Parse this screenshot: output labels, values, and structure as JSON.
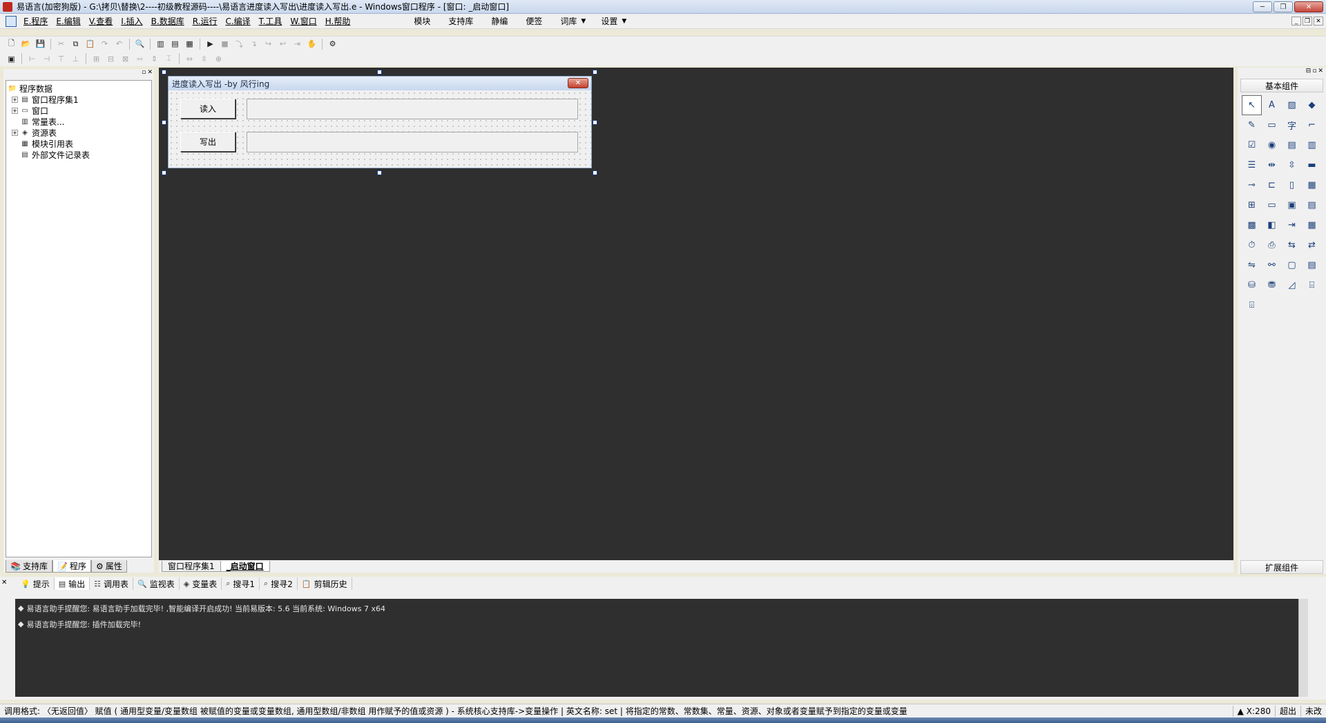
{
  "window": {
    "title": "易语言(加密狗版) - G:\\拷贝\\替换\\2----初级教程源码----\\易语言进度读入写出\\进度读入写出.e - Windows窗口程序 - [窗口: _启动窗口]",
    "min": "─",
    "max": "❐",
    "close": "✕"
  },
  "menu": {
    "items": [
      "E.程序",
      "E.编辑",
      "V.查看",
      "I.插入",
      "B.数据库",
      "R.运行",
      "C.编译",
      "T.工具",
      "W.窗口",
      "H.帮助"
    ],
    "extra": [
      "模块",
      "支持库",
      "静编",
      "便签",
      "词库",
      "设置"
    ],
    "mdi": [
      "_",
      "❐",
      "✕"
    ]
  },
  "left_panel": {
    "tree": [
      {
        "label": "程序数据",
        "expand": "",
        "icon": "📁"
      },
      {
        "label": "窗口程序集1",
        "expand": "+",
        "icon": "▤"
      },
      {
        "label": "窗口",
        "expand": "+",
        "icon": "▭"
      },
      {
        "label": "常量表...",
        "expand": "",
        "icon": "▥"
      },
      {
        "label": "资源表",
        "expand": "+",
        "icon": "◈"
      },
      {
        "label": "模块引用表",
        "expand": "",
        "icon": "▦"
      },
      {
        "label": "外部文件记录表",
        "expand": "",
        "icon": "▤"
      }
    ],
    "tabs": [
      "支持库",
      "程序",
      "属性"
    ]
  },
  "designer": {
    "title": "进度读入写出 -by 风行ing",
    "close": "✕",
    "read_button": "读入",
    "write_button": "写出"
  },
  "center_tabs": [
    "窗口程序集1",
    "_启动窗口"
  ],
  "right_panel": {
    "header": "基本组件",
    "footer": "扩展组件"
  },
  "output": {
    "tabs": [
      "提示",
      "输出",
      "调用表",
      "监视表",
      "变量表",
      "搜寻1",
      "搜寻2",
      "剪辑历史"
    ],
    "lines": [
      "易语言助手提醒您: 易语言助手加载完毕! ,智能编译开启成功! 当前易版本: 5.6  当前系统: Windows 7 x64",
      "易语言助手提醒您: 插件加载完毕!"
    ]
  },
  "status": {
    "main": "调用格式: 〈无返回值〉 赋值 ( 通用型变量/变量数组 被赋值的变量或变量数组, 通用型数组/非数组 用作赋予的值或资源 ) - 系统核心支持库->变量操作 | 英文名称: set | 将指定的常数、常数集、常量、资源、对象或者变量赋予到指定的变量或变量",
    "coord": "X:280",
    "mode1": "超出",
    "mode2": "未改"
  }
}
